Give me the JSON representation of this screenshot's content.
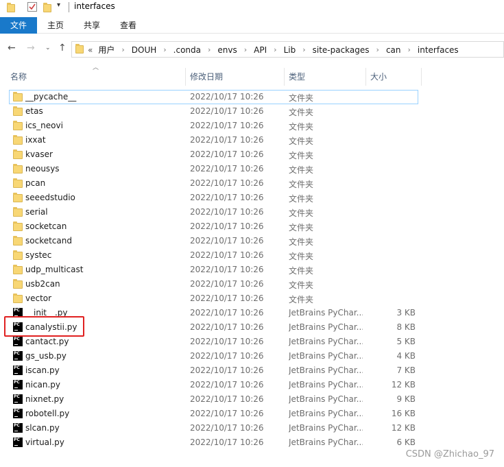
{
  "window": {
    "title": "interfaces"
  },
  "ribbon": {
    "tabs": [
      "文件",
      "主页",
      "共享",
      "查看"
    ]
  },
  "address": {
    "overflow": "«",
    "crumbs": [
      "用户",
      "DOUH",
      ".conda",
      "envs",
      "API",
      "Lib",
      "site-packages",
      "can",
      "interfaces"
    ]
  },
  "columns": {
    "name": "名称",
    "date": "修改日期",
    "type": "类型",
    "size": "大小"
  },
  "files": [
    {
      "name": "__pycache__",
      "date": "2022/10/17 10:26",
      "type": "文件夹",
      "size": "",
      "kind": "folder"
    },
    {
      "name": "etas",
      "date": "2022/10/17 10:26",
      "type": "文件夹",
      "size": "",
      "kind": "folder"
    },
    {
      "name": "ics_neovi",
      "date": "2022/10/17 10:26",
      "type": "文件夹",
      "size": "",
      "kind": "folder"
    },
    {
      "name": "ixxat",
      "date": "2022/10/17 10:26",
      "type": "文件夹",
      "size": "",
      "kind": "folder"
    },
    {
      "name": "kvaser",
      "date": "2022/10/17 10:26",
      "type": "文件夹",
      "size": "",
      "kind": "folder"
    },
    {
      "name": "neousys",
      "date": "2022/10/17 10:26",
      "type": "文件夹",
      "size": "",
      "kind": "folder"
    },
    {
      "name": "pcan",
      "date": "2022/10/17 10:26",
      "type": "文件夹",
      "size": "",
      "kind": "folder"
    },
    {
      "name": "seeedstudio",
      "date": "2022/10/17 10:26",
      "type": "文件夹",
      "size": "",
      "kind": "folder"
    },
    {
      "name": "serial",
      "date": "2022/10/17 10:26",
      "type": "文件夹",
      "size": "",
      "kind": "folder"
    },
    {
      "name": "socketcan",
      "date": "2022/10/17 10:26",
      "type": "文件夹",
      "size": "",
      "kind": "folder"
    },
    {
      "name": "socketcand",
      "date": "2022/10/17 10:26",
      "type": "文件夹",
      "size": "",
      "kind": "folder"
    },
    {
      "name": "systec",
      "date": "2022/10/17 10:26",
      "type": "文件夹",
      "size": "",
      "kind": "folder"
    },
    {
      "name": "udp_multicast",
      "date": "2022/10/17 10:26",
      "type": "文件夹",
      "size": "",
      "kind": "folder"
    },
    {
      "name": "usb2can",
      "date": "2022/10/17 10:26",
      "type": "文件夹",
      "size": "",
      "kind": "folder"
    },
    {
      "name": "vector",
      "date": "2022/10/17 10:26",
      "type": "文件夹",
      "size": "",
      "kind": "folder"
    },
    {
      "name": "__init__.py",
      "date": "2022/10/17 10:26",
      "type": "JetBrains PyChar...",
      "size": "3 KB",
      "kind": "py"
    },
    {
      "name": "canalystii.py",
      "date": "2022/10/17 10:26",
      "type": "JetBrains PyChar...",
      "size": "8 KB",
      "kind": "py"
    },
    {
      "name": "cantact.py",
      "date": "2022/10/17 10:26",
      "type": "JetBrains PyChar...",
      "size": "5 KB",
      "kind": "py"
    },
    {
      "name": "gs_usb.py",
      "date": "2022/10/17 10:26",
      "type": "JetBrains PyChar...",
      "size": "4 KB",
      "kind": "py"
    },
    {
      "name": "iscan.py",
      "date": "2022/10/17 10:26",
      "type": "JetBrains PyChar...",
      "size": "7 KB",
      "kind": "py"
    },
    {
      "name": "nican.py",
      "date": "2022/10/17 10:26",
      "type": "JetBrains PyChar...",
      "size": "12 KB",
      "kind": "py"
    },
    {
      "name": "nixnet.py",
      "date": "2022/10/17 10:26",
      "type": "JetBrains PyChar...",
      "size": "9 KB",
      "kind": "py"
    },
    {
      "name": "robotell.py",
      "date": "2022/10/17 10:26",
      "type": "JetBrains PyChar...",
      "size": "16 KB",
      "kind": "py"
    },
    {
      "name": "slcan.py",
      "date": "2022/10/17 10:26",
      "type": "JetBrains PyChar...",
      "size": "12 KB",
      "kind": "py"
    },
    {
      "name": "virtual.py",
      "date": "2022/10/17 10:26",
      "type": "JetBrains PyChar...",
      "size": "6 KB",
      "kind": "py"
    }
  ],
  "icons": {
    "pycharm_badge": "PC"
  },
  "watermark": "CSDN @Zhichao_97",
  "colors": {
    "file_tab": "#1979ca",
    "highlight_box": "#e02020",
    "folder": "#f8d775"
  }
}
